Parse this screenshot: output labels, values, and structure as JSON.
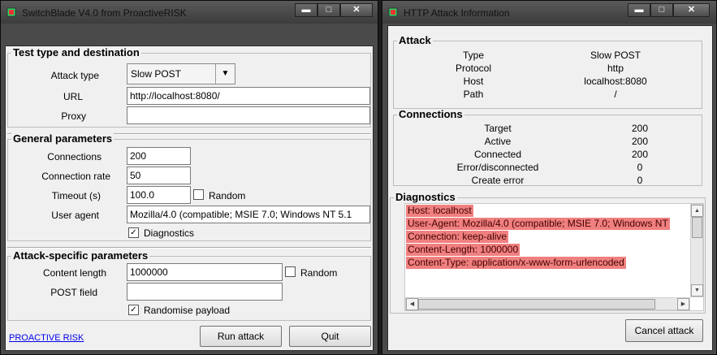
{
  "left_window": {
    "title": "SwitchBlade V4.0 from ProactiveRISK",
    "caption_buttons": {
      "minimize": "▬",
      "maximize": "□",
      "close": "✕"
    },
    "test_group": {
      "label": "Test type and destination",
      "attack_type_label": "Attack type",
      "attack_type_value": "Slow POST",
      "url_label": "URL",
      "url_value": "http://localhost:8080/",
      "proxy_label": "Proxy",
      "proxy_value": ""
    },
    "general_group": {
      "label": "General parameters",
      "connections_label": "Connections",
      "connections_value": "200",
      "rate_label": "Connection rate",
      "rate_value": "50",
      "timeout_label": "Timeout (s)",
      "timeout_value": "100.0",
      "timeout_random_label": "Random",
      "timeout_random_checked": false,
      "user_agent_label": "User agent",
      "user_agent_value": "Mozilla/4.0 (compatible; MSIE 7.0; Windows NT 5.1",
      "diagnostics_label": "Diagnostics",
      "diagnostics_checked": true,
      "check_mark": "✓"
    },
    "attack_group": {
      "label": "Attack-specific parameters",
      "content_length_label": "Content length",
      "content_length_value": "1000000",
      "content_random_label": "Random",
      "content_random_checked": false,
      "post_field_label": "POST field",
      "post_field_value": "",
      "randomise_label": "Randomise payload",
      "randomise_checked": true
    },
    "footer": {
      "link": "PROACTIVE RISK",
      "run_button": "Run attack",
      "quit_button": "Quit"
    }
  },
  "right_window": {
    "title": "HTTP Attack Information",
    "caption_buttons": {
      "minimize": "▬",
      "maximize": "□",
      "close": "✕"
    },
    "attack_group": {
      "label": "Attack",
      "rows": [
        {
          "key": "Type",
          "value": "Slow POST"
        },
        {
          "key": "Protocol",
          "value": "http"
        },
        {
          "key": "Host",
          "value": "localhost:8080"
        },
        {
          "key": "Path",
          "value": "/"
        }
      ]
    },
    "connections_group": {
      "label": "Connections",
      "rows": [
        {
          "key": "Target",
          "value": "200"
        },
        {
          "key": "Active",
          "value": "200"
        },
        {
          "key": "Connected",
          "value": "200"
        },
        {
          "key": "Error/disconnected",
          "value": "0"
        },
        {
          "key": "Create error",
          "value": "0"
        }
      ]
    },
    "diagnostics_group": {
      "label": "Diagnostics",
      "lines": [
        "Host: localhost",
        "User-Agent: Mozilla/4.0 (compatible; MSIE 7.0; Windows NT",
        "Connection: keep-alive",
        "Content-Length: 1000000",
        "Content-Type: application/x-www-form-urlencoded"
      ],
      "highlight_color": "#f08080"
    },
    "cancel_button": "Cancel attack"
  },
  "colors": {
    "frame": "#4a4a4a",
    "client": "#f0f0f0",
    "link": "#0000ee"
  }
}
